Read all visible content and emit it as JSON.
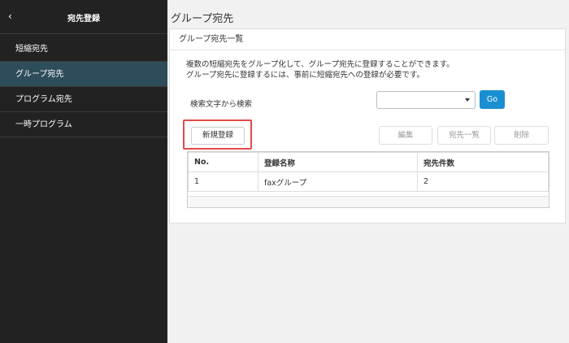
{
  "sidebar": {
    "title": "宛先登録",
    "back_icon": "‹",
    "items": [
      {
        "label": "短縮宛先"
      },
      {
        "label": "グループ宛先"
      },
      {
        "label": "プログラム宛先"
      },
      {
        "label": "一時プログラム"
      }
    ]
  },
  "main": {
    "title": "グループ宛先",
    "panel": {
      "header": "グループ宛先一覧",
      "desc_line1": "複数の短縮宛先をグループ化して、グループ宛先に登録することができます。",
      "desc_line2": "グループ宛先に登録するには、事前に短縮宛先への登録が必要です。",
      "search_label": "検索文字から検索",
      "search_value": "",
      "go_label": "Go",
      "new_label": "新規登録",
      "edit_label": "編集",
      "list_label": "宛先一覧",
      "delete_label": "削除",
      "table": {
        "headers": [
          "No.",
          "登録名称",
          "宛先件数"
        ],
        "rows": [
          [
            "1",
            "faxグループ",
            "2"
          ]
        ]
      }
    }
  },
  "colors": {
    "sidebar_bg": "#222222",
    "active_item": "#2e4d5a",
    "go_button": "#1a8fd1",
    "highlight": "#e34a4a"
  }
}
